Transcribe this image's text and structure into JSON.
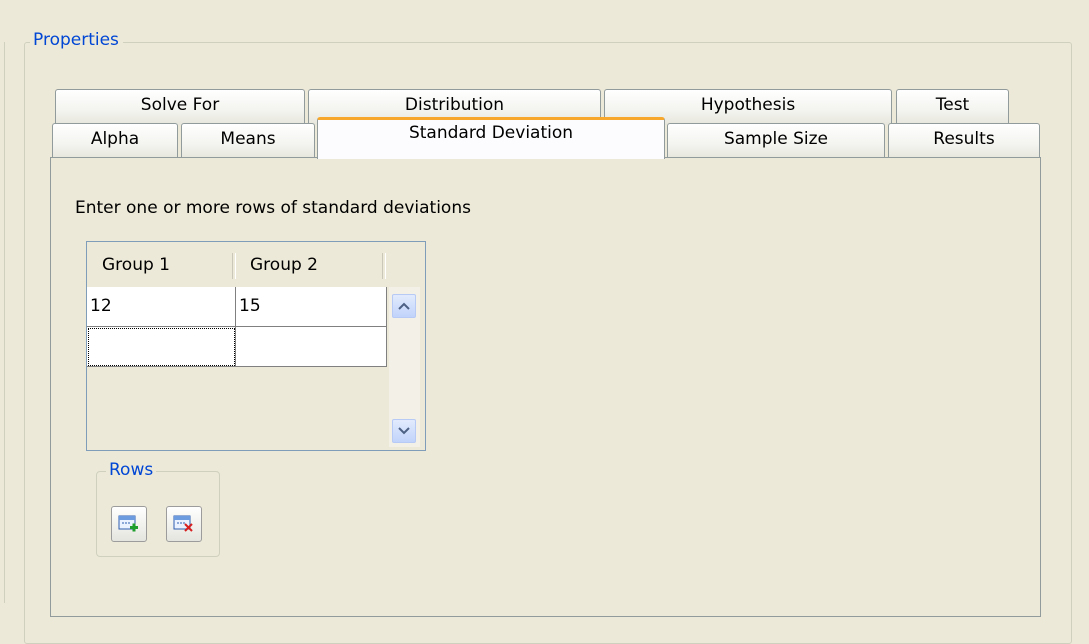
{
  "properties": {
    "title": "Properties"
  },
  "tabs": {
    "row_back": [
      "Solve For",
      "Distribution",
      "Hypothesis",
      "Test"
    ],
    "row_front": [
      "Alpha",
      "Means",
      "Standard Deviation",
      "Sample Size",
      "Results"
    ],
    "selected": "Standard Deviation"
  },
  "panel": {
    "instruction": "Enter one or more rows of standard deviations",
    "table": {
      "columns": [
        "Group 1",
        "Group 2"
      ],
      "rows": [
        [
          "12",
          "15"
        ],
        [
          "",
          ""
        ]
      ]
    },
    "rows_group": {
      "title": "Rows",
      "add_icon": "add-row-icon",
      "delete_icon": "delete-row-icon"
    }
  },
  "colors": {
    "accent": "#0046D5",
    "selected_tab_highlight": "#F7A82C",
    "background": "#ECE9D8"
  }
}
